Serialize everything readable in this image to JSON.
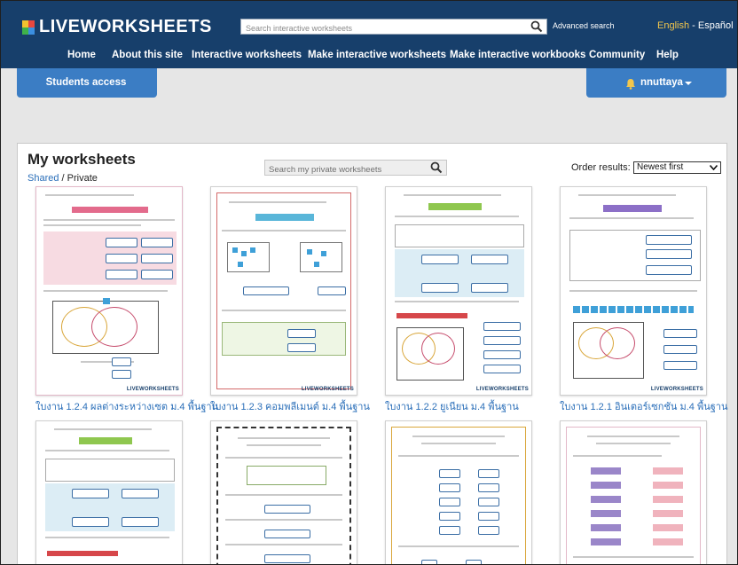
{
  "header": {
    "logo_text": "LIVEWORKSHEETS",
    "search_placeholder": "Search interactive worksheets",
    "advanced_search": "Advanced search",
    "lang_english": "English",
    "lang_sep": " - ",
    "lang_espanol": "Español",
    "nav": [
      "Home",
      "About this site",
      "Interactive worksheets",
      "Make interactive worksheets",
      "Make interactive workbooks",
      "Community",
      "Help"
    ]
  },
  "subbar": {
    "students_access": "Students access",
    "username": "nnuttaya"
  },
  "main": {
    "title": "My worksheets",
    "shared": "Shared",
    "separator": " / ",
    "private": "Private",
    "search_placeholder": "Search my private worksheets",
    "order_label": "Order results:",
    "order_value": "Newest first",
    "watermark": "LIVEWORKSHEETS",
    "worksheets": [
      {
        "title": "ใบงาน 1.2.4 ผลต่างระหว่างเซต ม.4 พื้นฐาน"
      },
      {
        "title": "ใบงาน 1.2.3 คอมพลีเมนต์ ม.4 พื้นฐาน"
      },
      {
        "title": "ใบงาน 1.2.2 ยูเนียน ม.4 พื้นฐาน"
      },
      {
        "title": "ใบงาน 1.2.1 อินเตอร์เซกชัน ม.4 พื้นฐาน"
      }
    ]
  },
  "colors": {
    "header_bg": "#173f6b",
    "accent_blue": "#3b7dc4",
    "link": "#2b6fb9",
    "lang_highlight": "#f3c74c"
  },
  "icons": [
    "logo-mark-icon",
    "search-icon",
    "bell-icon",
    "caret-down-icon",
    "chevron-down-icon"
  ]
}
